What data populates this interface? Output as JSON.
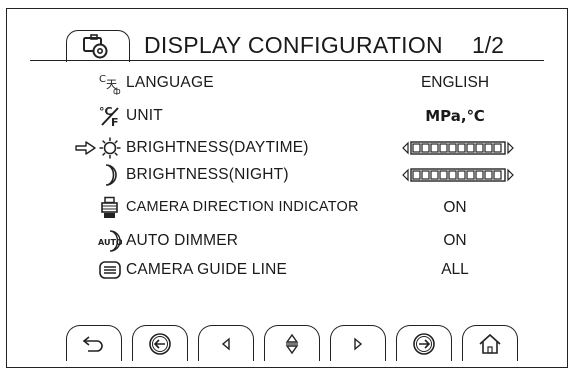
{
  "header": {
    "icon": "display-settings-icon",
    "title": "DISPLAY CONFIGURATION",
    "page": "1/2"
  },
  "menu": [
    {
      "id": "language",
      "icon": "language-icon",
      "label": "LANGUAGE",
      "value": "ENGLISH"
    },
    {
      "id": "unit",
      "icon": "unit-icon",
      "label": "UNIT",
      "value": "MPa,℃"
    },
    {
      "id": "brightness-day",
      "icon": "sun-icon",
      "label": "BRIGHTNESS(DAYTIME)",
      "value_type": "slider",
      "level": 1.0,
      "selected": true
    },
    {
      "id": "brightness-night",
      "icon": "moon-icon",
      "label": "BRIGHTNESS(NIGHT)",
      "value_type": "slider",
      "level": 1.0
    },
    {
      "id": "camera-direction",
      "icon": "camera-icon",
      "label": "CAMERA DIRECTION INDICATOR",
      "value": "ON"
    },
    {
      "id": "auto-dimmer",
      "icon": "auto-dimmer-icon",
      "label": "AUTO DIMMER",
      "value": "ON"
    },
    {
      "id": "camera-guide",
      "icon": "guide-line-icon",
      "label": "CAMERA GUIDE LINE",
      "value": "ALL"
    }
  ],
  "softkeys": [
    {
      "icon": "back-icon"
    },
    {
      "icon": "previous-page-icon"
    },
    {
      "icon": "left-arrow-icon"
    },
    {
      "icon": "up-down-icon"
    },
    {
      "icon": "right-arrow-icon"
    },
    {
      "icon": "next-page-icon"
    },
    {
      "icon": "home-icon"
    }
  ]
}
